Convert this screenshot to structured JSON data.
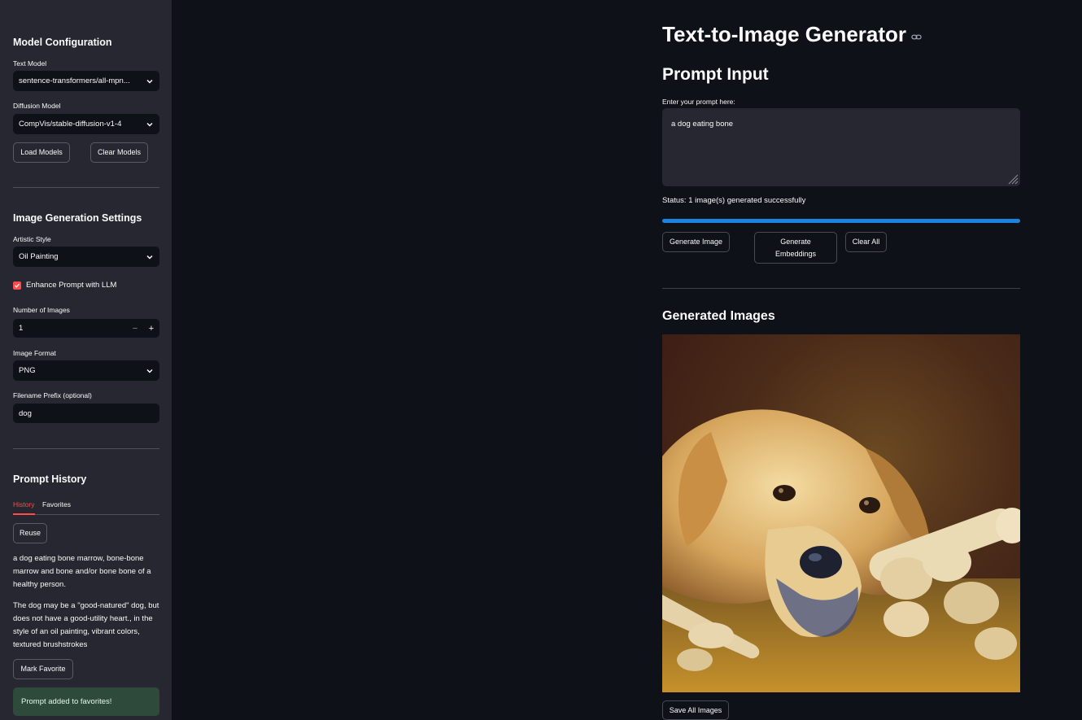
{
  "sidebar": {
    "model_config": {
      "heading": "Model Configuration",
      "text_model_label": "Text Model",
      "text_model_value": "sentence-transformers/all-mpn...",
      "diffusion_model_label": "Diffusion Model",
      "diffusion_model_value": "CompVis/stable-diffusion-v1-4",
      "load_button": "Load Models",
      "clear_button": "Clear Models"
    },
    "generation_settings": {
      "heading": "Image Generation Settings",
      "style_label": "Artistic Style",
      "style_value": "Oil Painting",
      "enhance_label": "Enhance Prompt with LLM",
      "enhance_checked": true,
      "num_images_label": "Number of Images",
      "num_images_value": "1",
      "minus": "−",
      "plus": "+",
      "format_label": "Image Format",
      "format_value": "PNG",
      "prefix_label": "Filename Prefix (optional)",
      "prefix_value": "dog"
    },
    "history": {
      "heading": "Prompt History",
      "tabs": [
        "History",
        "Favorites"
      ],
      "active_tab": "History",
      "reuse_button": "Reuse",
      "paragraph_1": "a dog eating bone marrow, bone-bone marrow and bone and/or bone bone of a healthy person.",
      "paragraph_2": "The dog may be a \"good-natured\" dog, but does not have a good-utility heart., in the style of an oil painting, vibrant colors, textured brushstrokes",
      "favorite_button": "Mark Favorite",
      "success_message": "Prompt added to favorites!"
    }
  },
  "main": {
    "title": "Text-to-Image Generator",
    "prompt_heading": "Prompt Input",
    "prompt_label": "Enter your prompt here:",
    "prompt_value": "a dog eating bone",
    "status": "Status: 1 image(s) generated successfully",
    "progress": 1.0,
    "buttons": {
      "generate_image": "Generate Image",
      "generate_embeddings_line1": "Generate",
      "generate_embeddings_line2": "Embeddings",
      "clear_all": "Clear All"
    },
    "images_heading": "Generated Images",
    "save_button": "Save All Images"
  },
  "colors": {
    "background": "#0e1117",
    "sidebar": "#262730",
    "accent": "#ff4b4b",
    "progress": "#1c83e1",
    "success_bg": "#2e4a3a"
  }
}
